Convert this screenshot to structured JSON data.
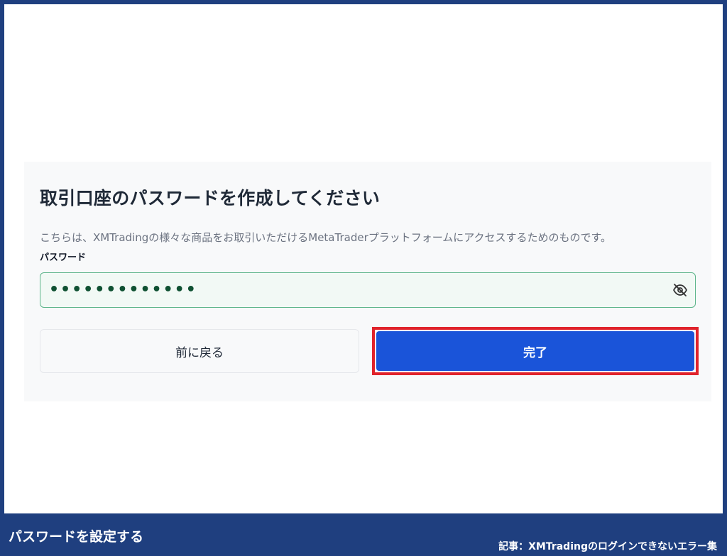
{
  "form": {
    "title": "取引口座のパスワードを作成してください",
    "description": "こちらは、XMTradingの様々な商品をお取引いただけるMetaTraderプラットフォームにアクセスするためのものです。",
    "password_label": "パスワード",
    "password_value": "•••••••••••••",
    "visibility_icon": "eye-off-icon",
    "back_label": "前に戻る",
    "complete_label": "完了"
  },
  "caption": {
    "left": "パスワードを設定する",
    "right": "記事：XMTradingのログインできないエラー集"
  },
  "colors": {
    "frame_border": "#1f3f7f",
    "primary_button": "#1a54d9",
    "highlight": "#e0232b",
    "field_border": "#5db58a"
  }
}
